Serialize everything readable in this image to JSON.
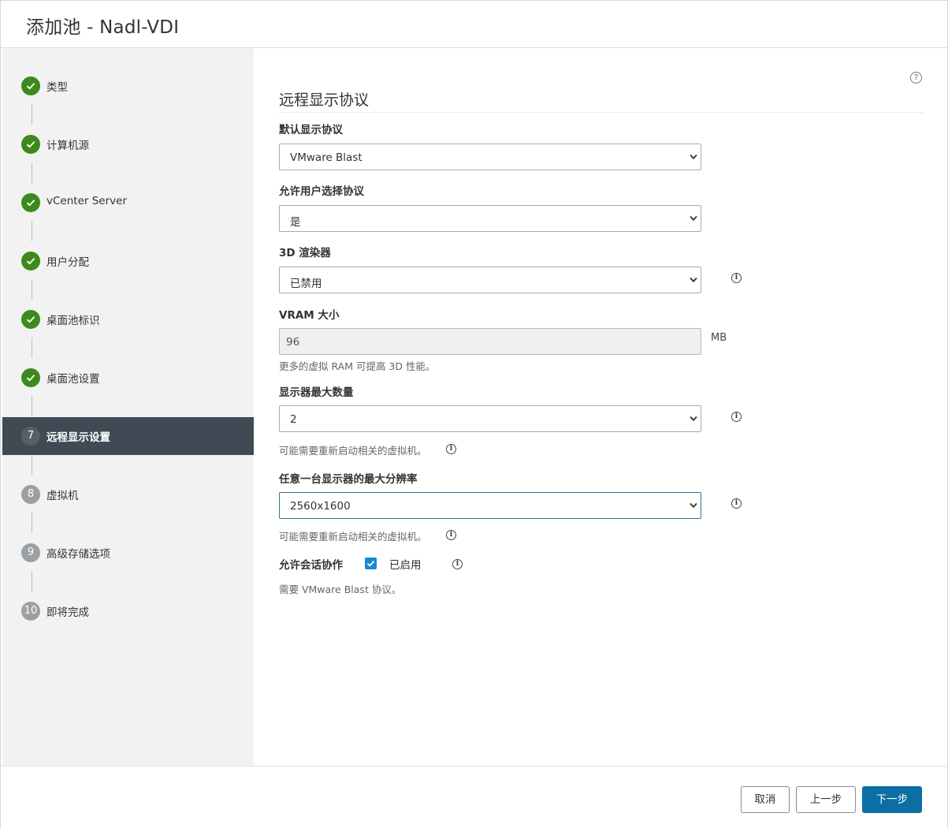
{
  "dialog": {
    "title": "添加池 - Nadl-VDI"
  },
  "steps": [
    {
      "number": "1",
      "label": "类型",
      "state": "done"
    },
    {
      "number": "2",
      "label": "计算机源",
      "state": "done"
    },
    {
      "number": "3",
      "label": "vCenter Server",
      "state": "done"
    },
    {
      "number": "4",
      "label": "用户分配",
      "state": "done"
    },
    {
      "number": "5",
      "label": "桌面池标识",
      "state": "done"
    },
    {
      "number": "6",
      "label": "桌面池设置",
      "state": "done"
    },
    {
      "number": "7",
      "label": "远程显示设置",
      "state": "current"
    },
    {
      "number": "8",
      "label": "虚拟机",
      "state": "pending"
    },
    {
      "number": "9",
      "label": "高级存储选项",
      "state": "pending"
    },
    {
      "number": "10",
      "label": "即将完成",
      "state": "pending"
    }
  ],
  "main": {
    "help_icon": "question-circle-icon",
    "section_title": "远程显示协议",
    "default_protocol": {
      "label": "默认显示协议",
      "value": "VMware Blast"
    },
    "allow_user_choose": {
      "label": "允许用户选择协议",
      "value": "是"
    },
    "renderer_3d": {
      "label": "3D 渲染器",
      "value": "已禁用"
    },
    "vram": {
      "label": "VRAM 大小",
      "value": "96",
      "unit": "MB",
      "hint": "更多的虚拟 RAM 可提高 3D 性能。"
    },
    "max_monitors": {
      "label": "显示器最大数量",
      "value": "2",
      "hint": "可能需要重新启动相关的虚拟机。"
    },
    "max_resolution": {
      "label": "任意一台显示器的最大分辨率",
      "value": "2560x1600",
      "hint": "可能需要重新启动相关的虚拟机。"
    },
    "session_collab": {
      "label": "允许会话协作",
      "checkbox_label": "已启用",
      "checked": true,
      "hint": "需要 VMware Blast 协议。"
    }
  },
  "footer": {
    "cancel": "取消",
    "prev": "上一步",
    "next": "下一步"
  },
  "colors": {
    "done": "#3d8a1c",
    "active_bg": "#3f4a55",
    "primary": "#0b6ea5",
    "checkbox": "#1a8ad0"
  }
}
